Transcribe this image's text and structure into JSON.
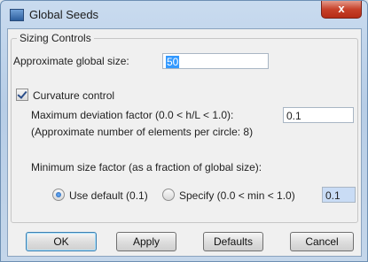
{
  "window": {
    "title": "Global Seeds",
    "close_label": "x"
  },
  "group": {
    "legend": "Sizing Controls"
  },
  "global_size": {
    "label": "Approximate global size:",
    "value": "50"
  },
  "curvature": {
    "checkbox_label": "Curvature control",
    "checked": true,
    "max_dev_label": "Maximum deviation factor (0.0 < h/L < 1.0):",
    "max_dev_value": "0.1",
    "approx_note": "(Approximate number of elements per circle: 8)"
  },
  "min_size": {
    "label": "Minimum size factor (as a fraction of global size):",
    "use_default_label": "Use default (0.1)",
    "specify_label": "Specify (0.0 < min < 1.0)",
    "specify_value": "0.1",
    "selected": "use_default"
  },
  "buttons": {
    "ok": "OK",
    "apply": "Apply",
    "defaults": "Defaults",
    "cancel": "Cancel"
  }
}
